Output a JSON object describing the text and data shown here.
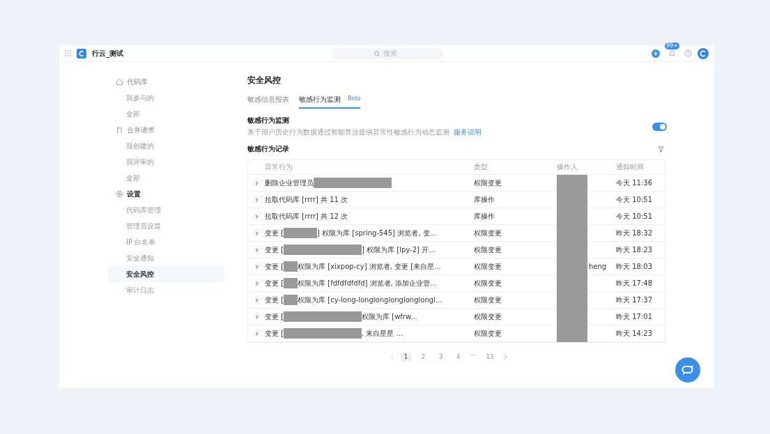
{
  "header": {
    "workspace": "行云_测试",
    "search": {
      "placeholder": "搜索"
    },
    "notification_badge": "99+"
  },
  "sidebar": {
    "groups": [
      {
        "label": "代码库",
        "items": [
          {
            "label": "我参与的",
            "selected": false
          },
          {
            "label": "全部",
            "selected": false
          }
        ]
      },
      {
        "label": "合并请求",
        "items": [
          {
            "label": "我创建的",
            "selected": false
          },
          {
            "label": "我评审的",
            "selected": false
          },
          {
            "label": "全部",
            "selected": false
          }
        ]
      },
      {
        "label": "设置",
        "items": [
          {
            "label": "代码库管理",
            "selected": false
          },
          {
            "label": "管理员设置",
            "selected": false
          },
          {
            "label": "IP 白名单",
            "selected": false
          },
          {
            "label": "安全通知",
            "selected": false
          },
          {
            "label": "安全风控",
            "selected": true
          },
          {
            "label": "审计日志",
            "selected": false
          }
        ]
      }
    ]
  },
  "page_title": "安全风控",
  "tabs": [
    {
      "label": "敏感信息报表",
      "selected": false
    },
    {
      "label": "敏感行为监测",
      "badge": "Beta",
      "selected": true
    }
  ],
  "monitor": {
    "title": "敏感行为监测",
    "description": "基于用户历史行为数据通过智能算法提供异常性敏感行为动态监测",
    "link": "服务说明",
    "on": true
  },
  "records": {
    "title": "敏感行为记录",
    "table": {
      "columns": [
        "异常行为",
        "类型",
        "操作人",
        "通知时间"
      ],
      "operator_redacted": true,
      "rows": [
        {
          "behavior": [
            {
              "kind": "text",
              "text": "删除企业管理员"
            },
            {
              "kind": "redaction-long"
            }
          ],
          "type": "权限变更",
          "time": "今天 11:36"
        },
        {
          "behavior": [
            {
              "kind": "text",
              "text": "拉取代码库 [rrrr] 共 11 次"
            }
          ],
          "type": "库操作",
          "time": "今天 10:51"
        },
        {
          "behavior": [
            {
              "kind": "text",
              "text": "拉取代码库 [rrrr] 共 12 次"
            }
          ],
          "type": "库操作",
          "time": "今天 10:51"
        },
        {
          "behavior": [
            {
              "kind": "text",
              "text": "变更 ["
            },
            {
              "kind": "redaction-medium"
            },
            {
              "kind": "text",
              "text": "] 权限为库 [spring-545] 浏览者, 变..."
            }
          ],
          "type": "权限变更",
          "time": "昨天 18:32"
        },
        {
          "behavior": [
            {
              "kind": "text",
              "text": "变更 ["
            },
            {
              "kind": "redaction-long"
            },
            {
              "kind": "text",
              "text": "] 权限为库 [lpy-2] 开..."
            }
          ],
          "type": "权限变更",
          "time": "昨天 18:23"
        },
        {
          "behavior": [
            {
              "kind": "text",
              "text": "变更 ["
            },
            {
              "kind": "redaction-short"
            },
            {
              "kind": "text",
              "text": "权限为库 [xixpop-cy] 浏览者, 变更 [来自星..."
            }
          ],
          "type": "权限变更",
          "operator": "heng",
          "time": "昨天 18:03"
        },
        {
          "behavior": [
            {
              "kind": "text",
              "text": "变更 ["
            },
            {
              "kind": "redaction-short"
            },
            {
              "kind": "text",
              "text": "权限为库 [fdfdfdfdfd] 浏览者, 添加企业管..."
            }
          ],
          "type": "权限变更",
          "time": "昨天 17:48"
        },
        {
          "behavior": [
            {
              "kind": "text",
              "text": "变更 ["
            },
            {
              "kind": "redaction-short"
            },
            {
              "kind": "text",
              "text": "权限为库 [cy-long-longlonglonglonglongl..."
            }
          ],
          "type": "权限变更",
          "time": "昨天 17:37"
        },
        {
          "behavior": [
            {
              "kind": "text",
              "text": "变更 ["
            },
            {
              "kind": "redaction-long"
            },
            {
              "kind": "text",
              "text": "权限为库 [wfrw..."
            }
          ],
          "type": "权限变更",
          "time": "昨天 17:01"
        },
        {
          "behavior": [
            {
              "kind": "text",
              "text": "变更 ["
            },
            {
              "kind": "redaction-long"
            },
            {
              "kind": "text",
              "text": ", 来自星星 ..."
            }
          ],
          "type": "权限变更",
          "time": "昨天 14:23"
        }
      ]
    }
  },
  "pagination": {
    "pages": [
      {
        "label": "1",
        "selected": true
      },
      {
        "label": "2",
        "selected": false
      },
      {
        "label": "3",
        "selected": false
      },
      {
        "label": "4",
        "selected": false
      },
      {
        "label": "···",
        "kind": "ellipsis"
      },
      {
        "label": "13",
        "selected": false
      }
    ]
  }
}
